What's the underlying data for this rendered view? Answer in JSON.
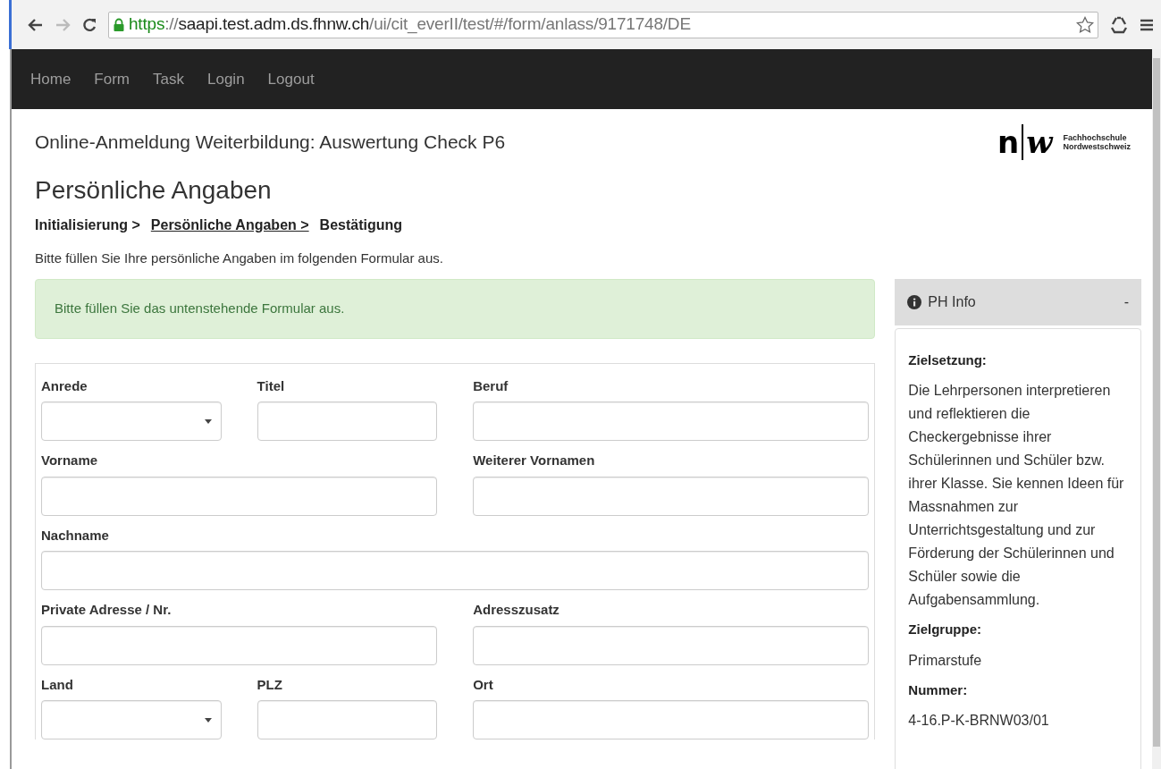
{
  "browser": {
    "back": {
      "disabled": false
    },
    "forward": {
      "disabled": true
    },
    "url": [
      {
        "text": "https",
        "kind": "scheme"
      },
      {
        "text": "://",
        "kind": "path"
      },
      {
        "text": "saapi.test.adm.ds.fhnw.ch",
        "kind": "host"
      },
      {
        "text": "/ui/cit_everII/test/#/form/anlass/9171748/DE",
        "kind": "path"
      }
    ]
  },
  "navbar": {
    "items": [
      "Home",
      "Form",
      "Task",
      "Login",
      "Logout"
    ]
  },
  "header": {
    "title": "Online-Anmeldung Weiterbildung: Auswertung Check P6",
    "logo": {
      "letters": [
        "n",
        "w"
      ],
      "name_lines": [
        "Fachhochschule",
        "Nordwestschweiz"
      ]
    }
  },
  "page_title": "Persönliche Angaben",
  "steps": [
    {
      "label": "Initialisierung >",
      "selected": false
    },
    {
      "label": "Persönliche Angaben >",
      "selected": true
    },
    {
      "label": "Bestätigung",
      "selected": false
    }
  ],
  "intro": "Bitte füllen Sie Ihre persönliche Angaben im folgenden Formular aus.",
  "alert": "Bitte füllen Sie das untenstehende Formular aus.",
  "form": {
    "rows": [
      [
        {
          "label": "Anrede",
          "kind": "select"
        },
        {
          "label": "Titel",
          "kind": "text"
        },
        {
          "label": "Beruf",
          "kind": "text"
        }
      ],
      [
        {
          "label": "Vorname",
          "kind": "text"
        },
        {
          "label": "Weiterer Vornamen",
          "kind": "text"
        }
      ],
      [
        {
          "label": "Nachname",
          "kind": "text"
        }
      ],
      [
        {
          "label": "Private Adresse / Nr.",
          "kind": "text"
        },
        {
          "label": "Adresszusatz",
          "kind": "text"
        }
      ],
      [
        {
          "label": "Land",
          "kind": "select"
        },
        {
          "label": "PLZ",
          "kind": "text"
        },
        {
          "label": "Ort",
          "kind": "text"
        }
      ]
    ]
  },
  "sidebar": {
    "title": "PH Info",
    "toggle": "-",
    "sections": [
      {
        "heading": "Zielsetzung:",
        "text": "Die Lehrpersonen interpretieren und reflektieren die Checkergebnisse ihrer Schülerinnen und Schüler bzw. ihrer Klasse. Sie kennen Ideen für Massnahmen zur Unterrichtsgestaltung und zur Förderung der Schülerinnen und Schüler sowie die Aufgabensammlung."
      },
      {
        "heading": "Zielgruppe:",
        "text": "Primarstufe"
      },
      {
        "heading": "Nummer:",
        "text": "4-16.P-K-BRNW03/01"
      }
    ]
  }
}
